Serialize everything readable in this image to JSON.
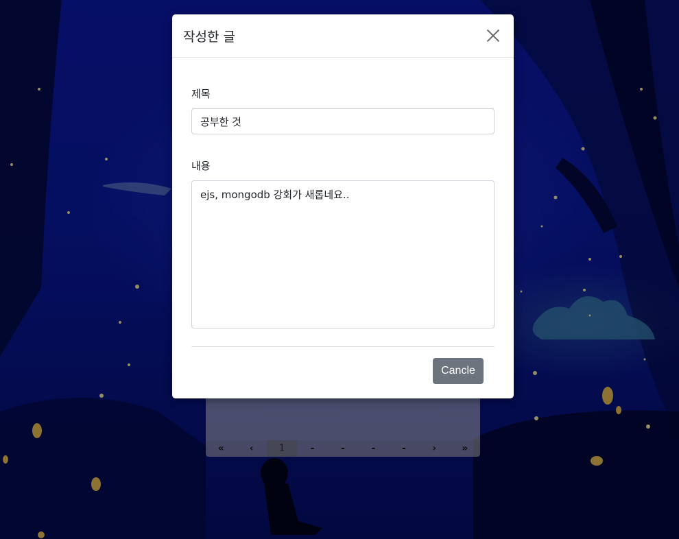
{
  "modal": {
    "title": "작성한 글",
    "title_label": "제목",
    "title_value": "공부한 것",
    "content_label": "내용",
    "content_value": "ejs, mongodb 강회가 새롭네요..",
    "cancel_label": "Cancle",
    "close_icon": "close-icon"
  },
  "pagination": {
    "first": "«",
    "prev": "‹",
    "pages": [
      "1",
      "-",
      "-",
      "-",
      "-"
    ],
    "active_page": "1",
    "next": "›",
    "last": "»"
  },
  "colors": {
    "background": "#0a1a8a",
    "cancel_button": "#6c757d",
    "modal": "#ffffff"
  }
}
